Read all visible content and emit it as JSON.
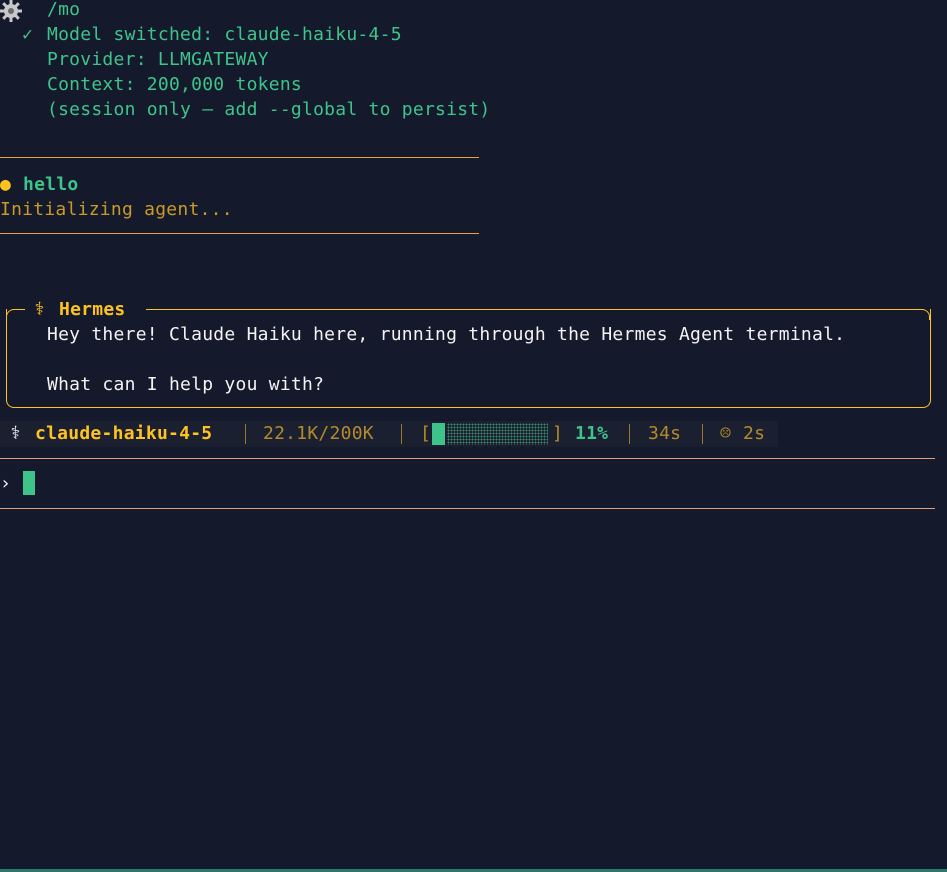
{
  "command_echo": {
    "icon": "gear-icon",
    "text": "/mo"
  },
  "model_switch": {
    "check": "✓",
    "switched": "Model switched: claude-haiku-4-5",
    "provider": "Provider: LLMGATEWAY",
    "context": "Context: 200,000 tokens",
    "note": "(session only — add --global to persist)"
  },
  "user_message": {
    "bullet": "●",
    "text": "hello",
    "status": "Initializing agent..."
  },
  "assistant": {
    "icon": "caduceus-icon",
    "glyph": "⚕",
    "name": "Hermes",
    "line1": "Hey there! Claude Haiku here, running through the Hermes Agent terminal.",
    "line2": "What can I help you with?"
  },
  "status_bar": {
    "glyph": "⚕",
    "model": "claude-haiku-4-5",
    "tokens": "22.1K/200K",
    "bracket_open": "[",
    "bracket_close": "]",
    "context_fraction": 0.11,
    "context_percent": "11%",
    "elapsed": "34s",
    "timer_icon": "☹",
    "timer": "2s"
  },
  "prompt": {
    "symbol": "›",
    "value": ""
  },
  "colors": {
    "background": "#141a2c",
    "green": "#3ec48a",
    "gold": "#ffc31f",
    "amber": "#c99a26",
    "rule_gold": "#ffc31f",
    "rule_salmon": "#e0a080"
  }
}
